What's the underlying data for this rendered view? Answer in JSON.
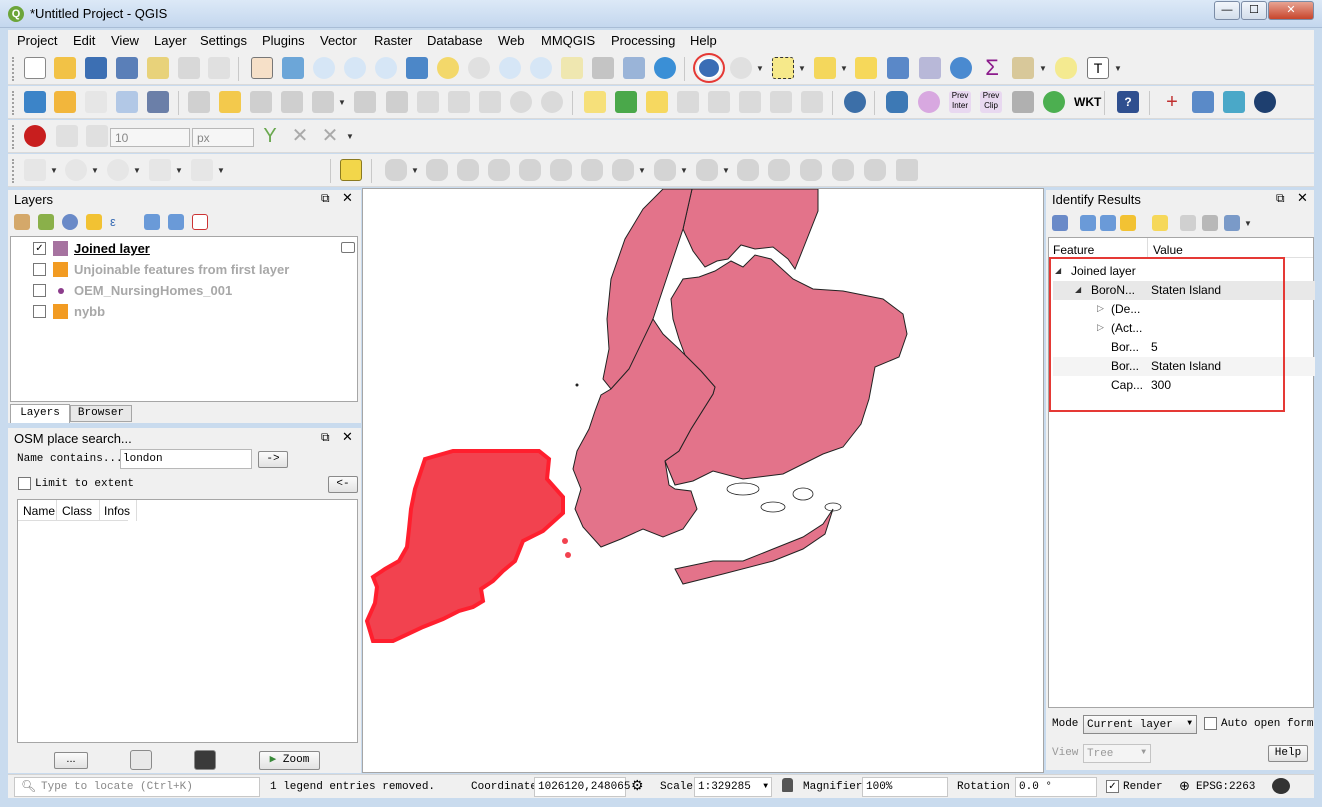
{
  "window": {
    "title": "*Untitled Project - QGIS",
    "logo": "Q",
    "min": "—",
    "max": "☐",
    "close": "✕"
  },
  "menu": [
    "Project",
    "Edit",
    "View",
    "Layer",
    "Settings",
    "Plugins",
    "Vector",
    "Raster",
    "Database",
    "Web",
    "MMQGIS",
    "Processing",
    "Help"
  ],
  "toolbar": {
    "snap_tolerance": "10",
    "snap_unit": "px",
    "prev_inter": "Prev\nInter",
    "prev_clip": "Prev\nClip",
    "wkt": "WKT"
  },
  "layers_panel": {
    "title": "Layers",
    "items": [
      {
        "label": "Joined layer",
        "checked": true,
        "color": "#a673a0",
        "active": true
      },
      {
        "label": "Unjoinable features from first layer",
        "checked": false,
        "color": "#f29b22"
      },
      {
        "label": "OEM_NursingHomes_001",
        "checked": false,
        "color": "#8c3d8c",
        "point": true
      },
      {
        "label": "nybb",
        "checked": false,
        "color": "#f29b22"
      }
    ],
    "tabs": [
      "Layers",
      "Browser"
    ]
  },
  "osm_panel": {
    "title": "OSM place search...",
    "name_label": "Name contains...",
    "name_value": "london",
    "go_button": "->",
    "limit_label": "Limit to extent",
    "back_button": "<-",
    "columns": [
      "Name",
      "Class",
      "Infos"
    ],
    "more_button": "...",
    "zoom_button": "Zoom"
  },
  "identify_panel": {
    "title": "Identify Results",
    "col_feature": "Feature",
    "col_value": "Value",
    "rows": [
      {
        "feature": "Joined layer",
        "value": "",
        "indent": 0,
        "arrow": "◢"
      },
      {
        "feature": "BoroN...",
        "value": "Staten Island",
        "indent": 1,
        "arrow": "◢"
      },
      {
        "feature": "(De...",
        "value": "",
        "indent": 2,
        "arrow": "▷"
      },
      {
        "feature": "(Act...",
        "value": "",
        "indent": 2,
        "arrow": "▷"
      },
      {
        "feature": "Bor...",
        "value": "5",
        "indent": 2,
        "arrow": ""
      },
      {
        "feature": "Bor...",
        "value": "Staten Island",
        "indent": 2,
        "arrow": ""
      },
      {
        "feature": "Cap...",
        "value": "300",
        "indent": 2,
        "arrow": ""
      }
    ],
    "mode_label": "Mode",
    "mode_value": "Current layer",
    "auto_open_label": "Auto open form",
    "view_label": "View",
    "view_value": "Tree",
    "help_button": "Help"
  },
  "statusbar": {
    "locate_placeholder": "Type to locate (Ctrl+K)",
    "message": "1 legend entries removed.",
    "coordinate_label": "Coordinate",
    "coordinate_value": "1026120,248065",
    "scale_label": "Scale",
    "scale_value": "1:329285",
    "magnifier_label": "Magnifier",
    "magnifier_value": "100%",
    "rotation_label": "Rotation",
    "rotation_value": "0.0 °",
    "render_label": "Render",
    "crs": "EPSG:2263"
  },
  "colors": {
    "boroughs": "#e3738a",
    "selected": "#f2424f",
    "highlight_box": "#e53935"
  }
}
